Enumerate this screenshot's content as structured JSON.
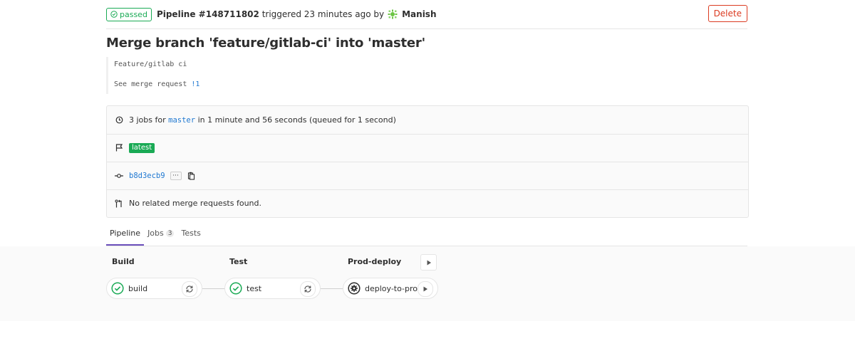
{
  "header": {
    "status_badge": "passed",
    "pipeline_label": "Pipeline #148711802",
    "triggered_text": "triggered 23 minutes ago by",
    "user_name": "Manish",
    "delete_label": "Delete"
  },
  "commit": {
    "title": "Merge branch 'feature/gitlab-ci' into 'master'",
    "description_line1": "Feature/gitlab ci",
    "description_line2_prefix": "See merge request",
    "merge_request_link": "!1"
  },
  "info": {
    "jobs_prefix": "3 jobs for",
    "branch": "master",
    "jobs_suffix": "in 1 minute and 56 seconds (queued for 1 second)",
    "latest_tag": "latest",
    "sha": "b8d3ecb9",
    "ellipsis": "···",
    "no_mr_text": "No related merge requests found."
  },
  "tabs": [
    {
      "label": "Pipeline",
      "count": null
    },
    {
      "label": "Jobs",
      "count": "3"
    },
    {
      "label": "Tests",
      "count": null
    }
  ],
  "stages": [
    {
      "title": "Build",
      "job": "build",
      "status": "success",
      "action_icon": "retry-icon"
    },
    {
      "title": "Test",
      "job": "test",
      "status": "success",
      "action_icon": "retry-icon"
    },
    {
      "title": "Prod-deploy",
      "job": "deploy-to-prod",
      "status": "manual",
      "action_icon": "play-icon"
    }
  ],
  "colors": {
    "success": "#1aaa55",
    "danger": "#db3b21",
    "link": "#1f78d1",
    "tab_active": "#6b4fbb"
  }
}
